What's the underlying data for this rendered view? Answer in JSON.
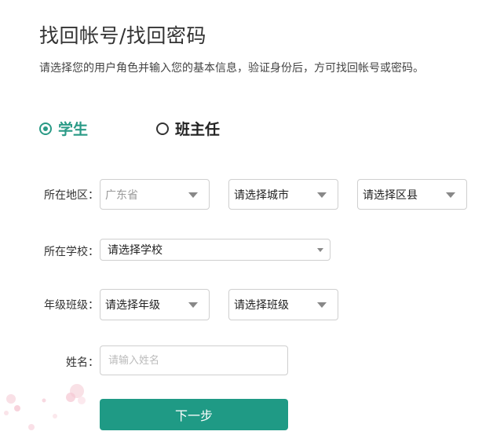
{
  "page": {
    "title": "找回帐号/找回密码",
    "subtitle": "请选择您的用户角色并输入您的基本信息，验证身份后，方可找回帐号或密码。"
  },
  "roles": {
    "student": {
      "label": "学生",
      "selected": true
    },
    "teacher": {
      "label": "班主任",
      "selected": false
    }
  },
  "form": {
    "region": {
      "label": "所在地区：",
      "province": "广东省",
      "city": "请选择城市",
      "district": "请选择区县"
    },
    "school": {
      "label": "所在学校：",
      "value": "请选择学校"
    },
    "class": {
      "label": "年级班级：",
      "grade": "请选择年级",
      "class": "请选择班级"
    },
    "name": {
      "label": "姓名：",
      "placeholder": "请输入姓名"
    }
  },
  "actions": {
    "next_label": "下一步"
  },
  "colors": {
    "accent": "#1f9a85",
    "selected_role": "#2a9a86"
  }
}
